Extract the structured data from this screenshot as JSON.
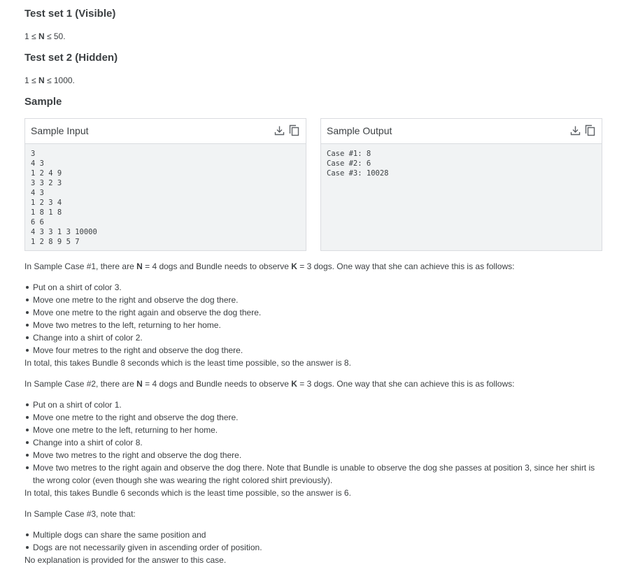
{
  "test_sets": [
    {
      "title": "Test set 1 (Visible)",
      "pre": "1 ≤ ",
      "var": "N",
      "post": " ≤ 50."
    },
    {
      "title": "Test set 2 (Hidden)",
      "pre": "1 ≤ ",
      "var": "N",
      "post": " ≤ 1000."
    }
  ],
  "sample_heading": "Sample",
  "sample_input": {
    "title": "Sample Input",
    "content": "3\n4 3\n1 2 4 9\n3 3 2 3\n4 3\n1 2 3 4\n1 8 1 8\n6 6\n4 3 3 1 3 10000\n1 2 8 9 5 7"
  },
  "sample_output": {
    "title": "Sample Output",
    "content": "Case #1: 8\nCase #2: 6\nCase #3: 10028"
  },
  "case1": {
    "intro_a": "In Sample Case #1, there are ",
    "n_label": "N",
    "intro_b": " = 4 dogs and Bundle needs to observe ",
    "k_label": "K",
    "intro_c": " = 3 dogs. One way that she can achieve this is as follows:",
    "steps": [
      "Put on a shirt of color 3.",
      "Move one metre to the right and observe the dog there.",
      "Move one metre to the right again and observe the dog there.",
      "Move two metres to the left, returning to her home.",
      "Change into a shirt of color 2.",
      "Move four metres to the right and observe the dog there."
    ],
    "conclusion": "In total, this takes Bundle 8 seconds which is the least time possible, so the answer is 8."
  },
  "case2": {
    "intro_a": "In Sample Case #2, there are ",
    "n_label": "N",
    "intro_b": " = 4 dogs and Bundle needs to observe ",
    "k_label": "K",
    "intro_c": " = 3 dogs. One way that she can achieve this is as follows:",
    "steps": [
      "Put on a shirt of color 1.",
      "Move one metre to the right and observe the dog there.",
      "Move one metre to the left, returning to her home.",
      "Change into a shirt of color 8.",
      "Move two metres to the right and observe the dog there.",
      "Move two metres to the right again and observe the dog there. Note that Bundle is unable to observe the dog she passes at position 3, since her shirt is the wrong color (even though she was wearing the right colored shirt previously)."
    ],
    "conclusion": "In total, this takes Bundle 6 seconds which is the least time possible, so the answer is 6."
  },
  "case3": {
    "intro": "In Sample Case #3, note that:",
    "notes": [
      "Multiple dogs can share the same position and",
      "Dogs are not necessarily given in ascending order of position."
    ],
    "conclusion": "No explanation is provided for the answer to this case."
  }
}
